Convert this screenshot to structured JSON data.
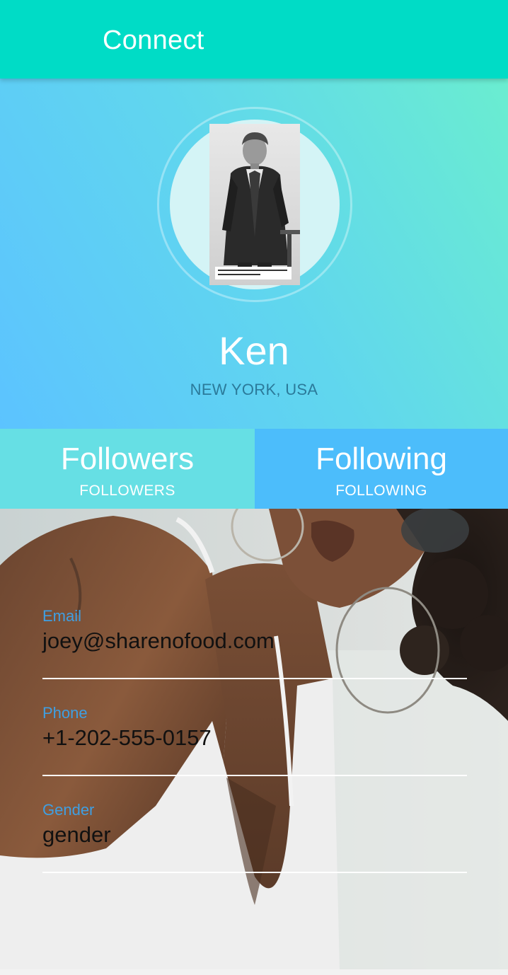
{
  "appbar": {
    "title": "Connect"
  },
  "profile": {
    "name": "Ken",
    "location": "NEW YORK, USA",
    "avatar_icon": "profile-portrait"
  },
  "stats": {
    "followers": {
      "value": "Followers",
      "label": "FOLLOWERS"
    },
    "following": {
      "value": "Following",
      "label": "FOLLOWING"
    }
  },
  "fields": {
    "email": {
      "label": "Email",
      "value": "joey@sharenofood.com"
    },
    "phone": {
      "label": "Phone",
      "value": "+1-202-555-0157"
    },
    "gender": {
      "label": "Gender",
      "value": "gender"
    }
  },
  "colors": {
    "appbar": "#00dcc6",
    "followers_bg": "#66dfe4",
    "following_bg": "#4cbdfb",
    "field_label": "#3f9fe2"
  }
}
